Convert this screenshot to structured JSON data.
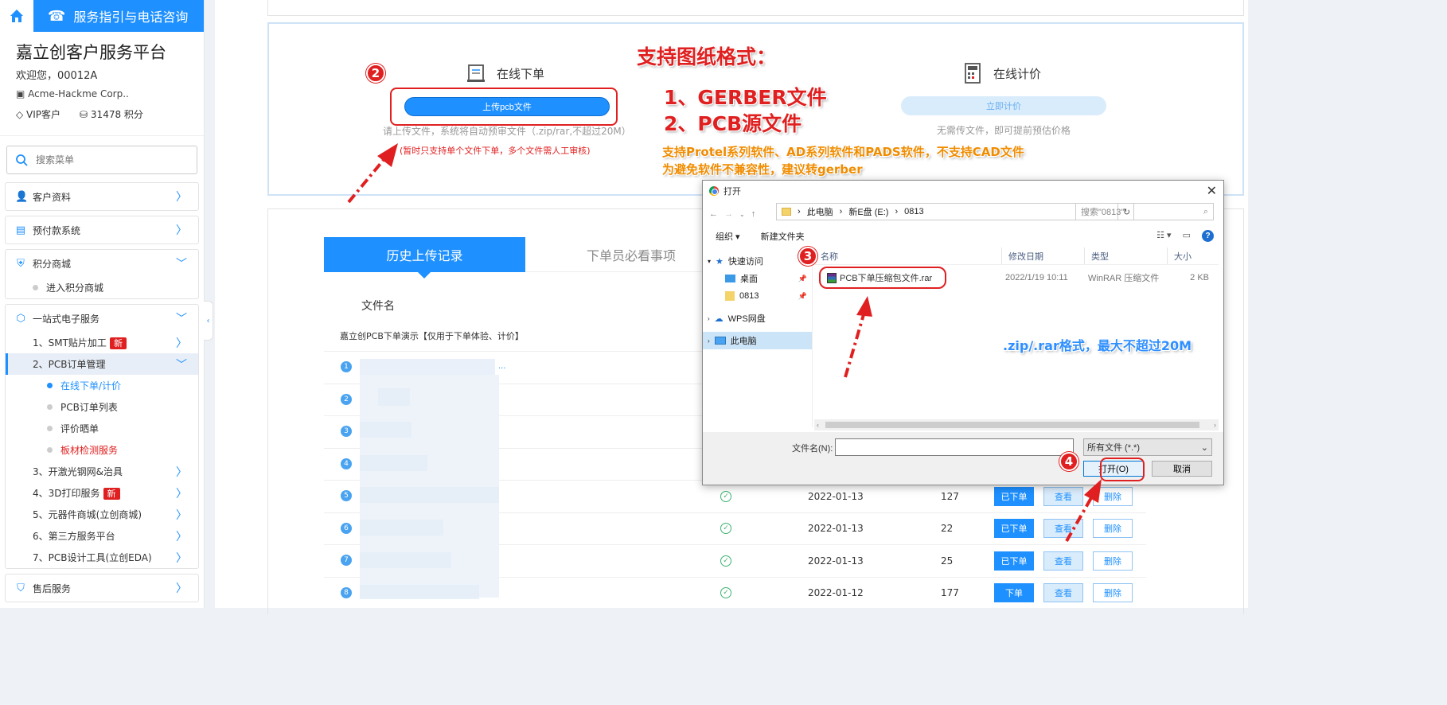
{
  "sidebar": {
    "service_tab": "服务指引与电话咨询",
    "platform_title": "嘉立创客户服务平台",
    "welcome": "欢迎您，00012A",
    "company": "Acme-Hackme Corp..",
    "vip": "VIP客户",
    "points": "31478 积分",
    "search_placeholder": "搜索菜单",
    "menu": {
      "customer": "客户资料",
      "prepay": "预付款系统",
      "points_mall": "积分商城",
      "enter_points_mall": "进入积分商城",
      "one_stop": "一站式电子服务",
      "smt": "1、SMT贴片加工",
      "pcb_order": "2、PCB订单管理",
      "online_order": "在线下单/计价",
      "pcb_list": "PCB订单列表",
      "review": "评价晒单",
      "board_test": "板材检测服务",
      "laser": "3、开激光钢网&治具",
      "print3d": "4、3D打印服务",
      "components": "5、元器件商城(立创商城)",
      "third_party": "6、第三方服务平台",
      "pcb_design": "7、PCB设计工具(立创EDA)",
      "after_sales": "售后服务",
      "new_badge": "新"
    }
  },
  "order": {
    "online_order_title": "在线下单",
    "upload_btn": "上传pcb文件",
    "upload_hint": "请上传文件，系统将自动预审文件（.zip/rar,不超过20M）",
    "upload_note": "(暂时只支持单个文件下单，多个文件需人工审核)",
    "online_price_title": "在线计价",
    "price_btn": "立即计价",
    "price_hint": "无需传文件，即可提前预估价格"
  },
  "annotations": {
    "formats_title": "支持图纸格式：",
    "format1": "1、GERBER文件",
    "format2": "2、PCB源文件",
    "software_note1": "支持Protel系列软件、AD系列软件和PADS软件，不支持CAD文件",
    "software_note2": "为避免软件不兼容性，建议转gerber",
    "size_note": ".zip/.rar格式，最大不超过20M",
    "step2": "2",
    "step3": "3",
    "step4": "4"
  },
  "history": {
    "tab_history": "历史上传记录",
    "tab_notice": "下单员必看事项",
    "col_filename": "文件名",
    "demo_row": "嘉立创PCB下单演示【仅用于下单体验、计价】",
    "ellipsis": "...",
    "view_label": "查看",
    "delete_label": "删除",
    "rows": [
      {
        "num": "1"
      },
      {
        "num": "2"
      },
      {
        "num": "3"
      },
      {
        "num": "4"
      },
      {
        "num": "5",
        "date": "2022-01-13",
        "count": "127",
        "status": "已下单"
      },
      {
        "num": "6",
        "date": "2022-01-13",
        "count": "22",
        "status": "已下单"
      },
      {
        "num": "7",
        "date": "2022-01-13",
        "count": "25",
        "status": "已下单"
      },
      {
        "num": "8",
        "date": "2022-01-12",
        "count": "177",
        "status": "下单"
      }
    ]
  },
  "dialog": {
    "title": "打开",
    "close": "✕",
    "path": [
      "此电脑",
      "新E盘 (E:)",
      "0813"
    ],
    "search_placeholder": "搜索\"0813\"",
    "organize": "组织",
    "new_folder": "新建文件夹",
    "nav": {
      "quick_access": "快速访问",
      "desktop": "桌面",
      "folder0813": "0813",
      "wps": "WPS网盘",
      "this_pc": "此电脑"
    },
    "columns": {
      "name": "名称",
      "modified": "修改日期",
      "type": "类型",
      "size": "大小"
    },
    "file": {
      "name": "PCB下单压缩包文件.rar",
      "modified": "2022/1/19 10:11",
      "type": "WinRAR 压缩文件",
      "size": "2 KB"
    },
    "filename_label": "文件名(N):",
    "filetype": "所有文件 (*.*)",
    "open_btn": "打开(O)",
    "cancel_btn": "取消"
  }
}
